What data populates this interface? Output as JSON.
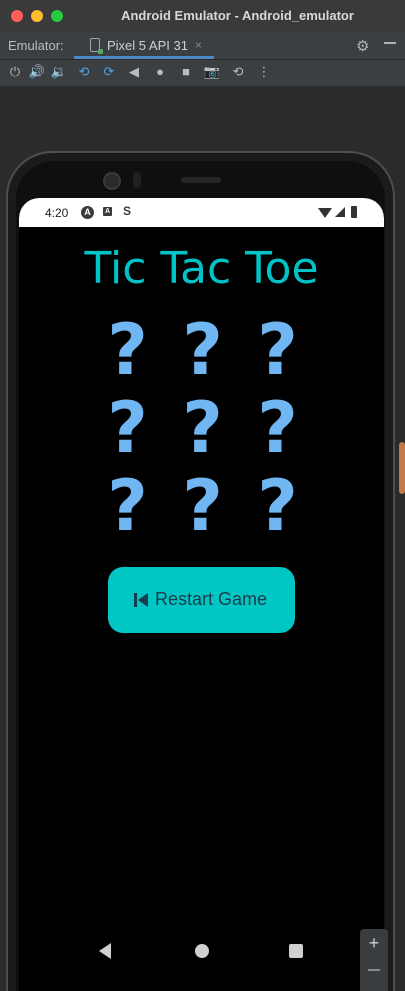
{
  "window": {
    "title": "Android Emulator - Android_emulator"
  },
  "emulator_bar": {
    "label": "Emulator:",
    "device_tab": "Pixel 5 API 31",
    "close_glyph": "×"
  },
  "toolbar": {
    "icons": [
      "power-icon",
      "volume-up-icon",
      "volume-down-icon",
      "rotate-left-icon",
      "rotate-right-icon",
      "back-icon",
      "home-icon",
      "overview-icon",
      "screenshot-icon",
      "snapshot-icon",
      "more-icon"
    ]
  },
  "status_bar": {
    "time": "4:20",
    "icon_a": "A",
    "icon_sq": "A",
    "icon_s": "S"
  },
  "app": {
    "title": "Tic Tac Toe",
    "board": [
      "?",
      "?",
      "?",
      "?",
      "?",
      "?",
      "?",
      "?",
      "?"
    ],
    "restart_label": "Restart Game"
  },
  "zoom": {
    "plus": "+"
  },
  "colors": {
    "title_color": "#00c3c8",
    "cell_color": "#6fb6f2",
    "button_bg": "#00c7c4",
    "button_text": "#1b3a4b"
  }
}
